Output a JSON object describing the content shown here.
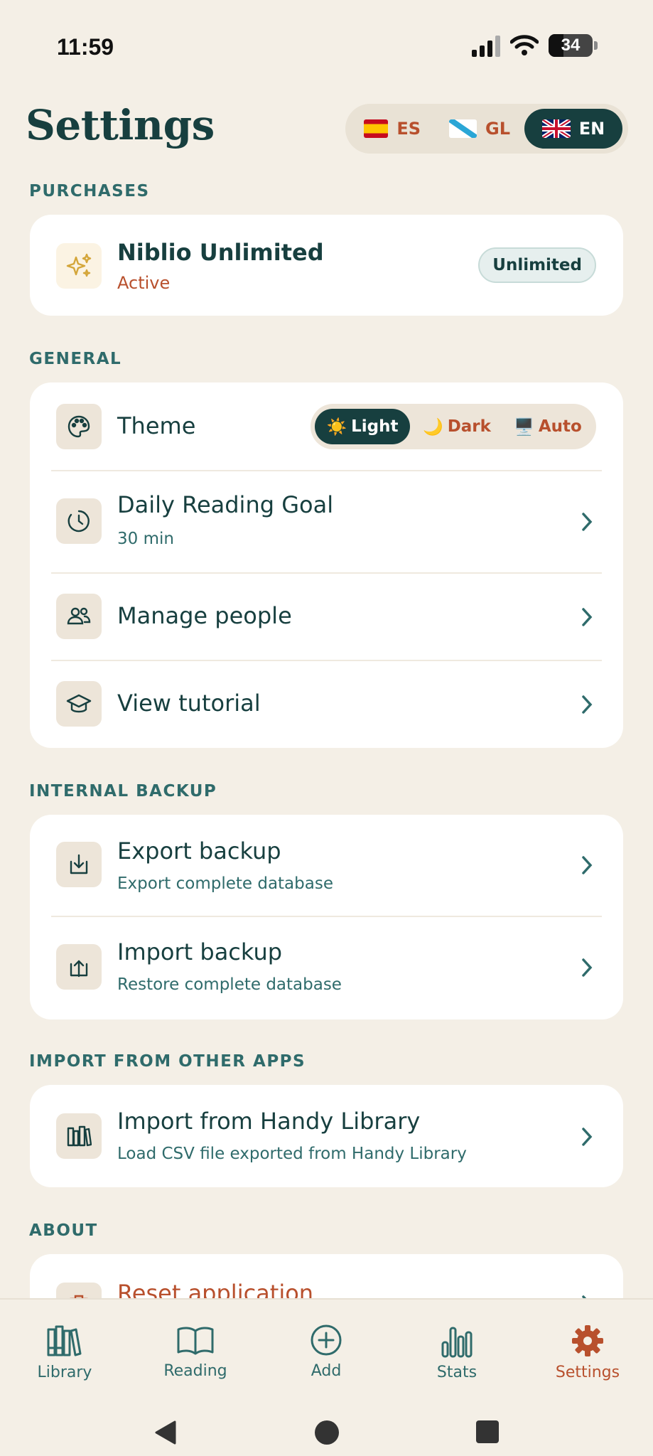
{
  "status": {
    "time": "11:59",
    "battery": "34"
  },
  "header": {
    "title": "Settings",
    "languages": [
      {
        "code": "ES",
        "active": false
      },
      {
        "code": "GL",
        "active": false
      },
      {
        "code": "EN",
        "active": true
      }
    ]
  },
  "purchases": {
    "label": "PURCHASES",
    "title": "Niblio Unlimited",
    "status": "Active",
    "badge": "Unlimited"
  },
  "general": {
    "label": "GENERAL",
    "theme": {
      "title": "Theme",
      "options": [
        {
          "icon": "☀️",
          "label": "Light",
          "active": true
        },
        {
          "icon": "🌙",
          "label": "Dark",
          "active": false
        },
        {
          "icon": "🖥️",
          "label": "Auto",
          "active": false
        }
      ]
    },
    "daily_goal": {
      "title": "Daily Reading Goal",
      "value": "30 min"
    },
    "manage_people": {
      "title": "Manage people"
    },
    "tutorial": {
      "title": "View tutorial"
    }
  },
  "internal_backup": {
    "label": "INTERNAL BACKUP",
    "export": {
      "title": "Export backup",
      "sub": "Export complete database"
    },
    "import": {
      "title": "Import backup",
      "sub": "Restore complete database"
    }
  },
  "import_other": {
    "label": "IMPORT FROM OTHER APPS",
    "handy": {
      "title": "Import from Handy Library",
      "sub": "Load CSV file exported from Handy Library"
    }
  },
  "about": {
    "label": "ABOUT",
    "reset": {
      "title": "Reset application"
    }
  },
  "nav": {
    "items": [
      {
        "label": "Library",
        "icon": "library-icon",
        "active": false
      },
      {
        "label": "Reading",
        "icon": "book-icon",
        "active": false
      },
      {
        "label": "Add",
        "icon": "add-icon",
        "active": false
      },
      {
        "label": "Stats",
        "icon": "stats-icon",
        "active": false
      },
      {
        "label": "Settings",
        "icon": "gear-icon",
        "active": true
      }
    ]
  },
  "colors": {
    "background": "#f4efe6",
    "primary": "#173f3f",
    "accent": "#b8502d",
    "teal_text": "#2f6b6b"
  }
}
